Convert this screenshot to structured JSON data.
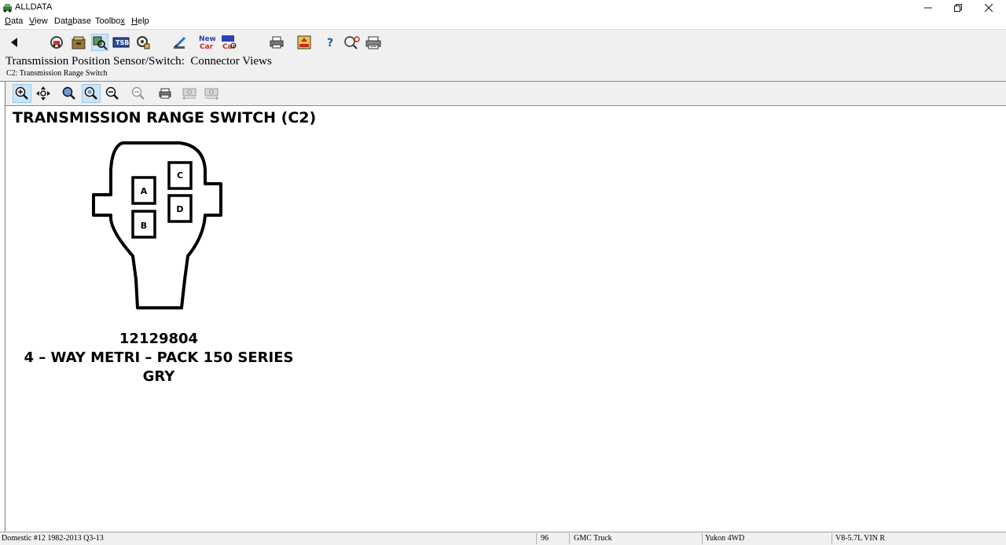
{
  "window": {
    "title": "ALLDATA"
  },
  "menu": {
    "items": [
      {
        "label_pre": "",
        "label_u": "D",
        "label_post": "ata"
      },
      {
        "label_pre": "",
        "label_u": "V",
        "label_post": "iew"
      },
      {
        "label_pre": "Dat",
        "label_u": "a",
        "label_post": "base"
      },
      {
        "label_pre": "Toolbo",
        "label_u": "x",
        "label_post": ""
      },
      {
        "label_pre": "",
        "label_u": "H",
        "label_post": "elp"
      }
    ]
  },
  "toolbar": {
    "buttons": [
      "back-icon",
      "vehicle-search-icon",
      "filing-cabinet-icon",
      "component-search-icon",
      "tsb-icon",
      "tools-icon",
      "pen-icon",
      "new-car-icon",
      "new-car-alt-icon",
      "print-icon",
      "note-icon",
      "help-icon",
      "search-icon",
      "printer-setup-icon"
    ],
    "new_car_line1": "New",
    "new_car_line2": "Car"
  },
  "header": {
    "title": "Transmission Position Sensor/Switch:  Connector Views",
    "subtitle": "C2: Transmission Range Switch"
  },
  "viewer_toolbar": {
    "buttons": [
      "zoom-in-icon",
      "pan-icon",
      "zoom-fit-icon",
      "zoom-window-icon",
      "zoom-out-icon",
      "zoom-reset-icon",
      "print-icon",
      "prev-image-icon",
      "next-image-icon"
    ],
    "active": [
      "zoom-in-icon",
      "zoom-window-icon"
    ]
  },
  "diagram": {
    "title": "TRANSMISSION RANGE SWITCH (C2)",
    "pins": [
      "A",
      "B",
      "C",
      "D"
    ],
    "part_number": "12129804",
    "description": "4 – WAY METRI – PACK 150 SERIES",
    "color": "GRY"
  },
  "status": {
    "database": "Domestic #12 1982-2013 Q3-13",
    "code": "96",
    "make": "GMC Truck",
    "model": "Yukon 4WD",
    "engine": "V8-5.7L VIN R"
  },
  "colors": {
    "toolbar_bg": "#f0f0f0",
    "active_button": "#cce4f7",
    "diagram_ink": "#000000"
  }
}
